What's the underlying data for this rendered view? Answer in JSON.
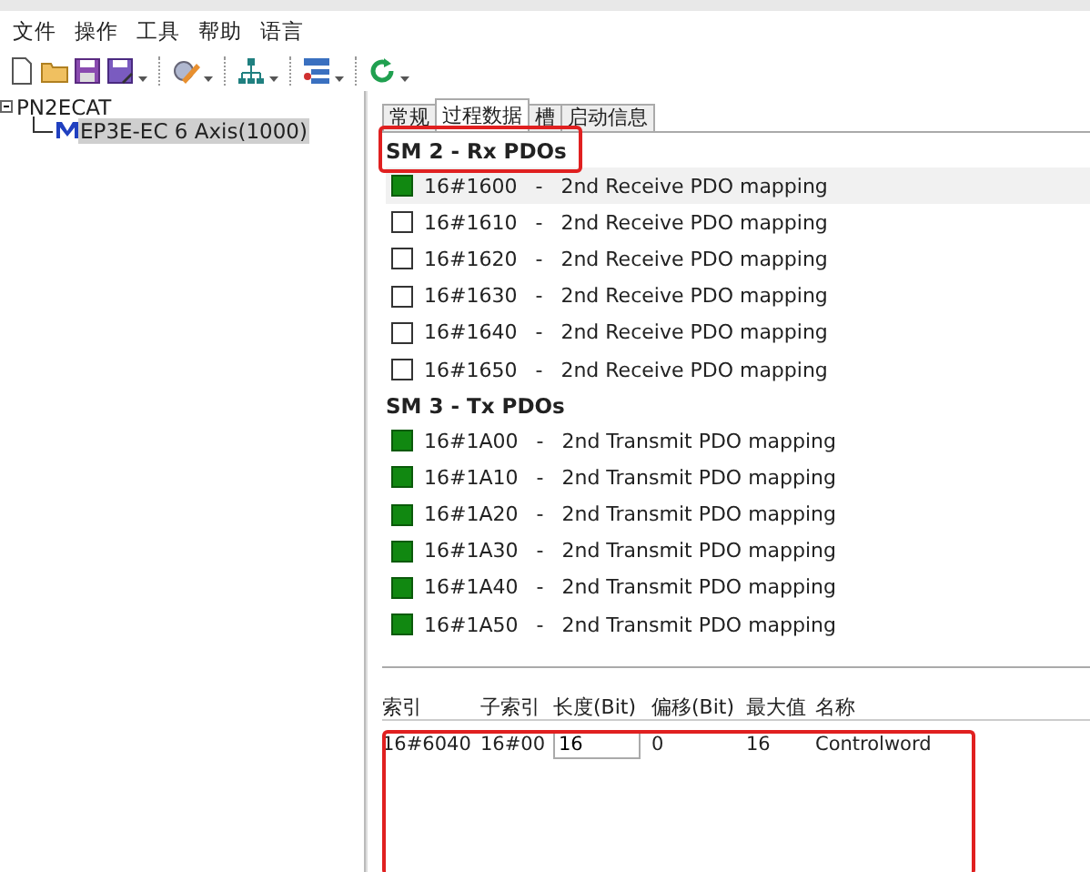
{
  "menu": [
    "文件",
    "操作",
    "工具",
    "帮助",
    "语言"
  ],
  "toolbar": [
    {
      "kind": "new"
    },
    {
      "kind": "open"
    },
    {
      "kind": "save"
    },
    {
      "kind": "saveas",
      "dropdown": true
    },
    {
      "kind": "edit",
      "dropdown": true
    },
    {
      "kind": "network",
      "dropdown": true
    },
    {
      "kind": "list",
      "dropdown": true
    },
    {
      "kind": "refresh",
      "dropdown": true
    }
  ],
  "tree": [
    {
      "label": "PN2ECAT",
      "expanded": true,
      "selected": false,
      "children": [
        {
          "label": "EP3E-EC 6 Axis(1000)",
          "selected": true
        }
      ]
    }
  ],
  "tabs": [
    {
      "label": "常规",
      "selected": false
    },
    {
      "label": "过程数据",
      "selected": true
    },
    {
      "label": "槽",
      "selected": false
    },
    {
      "label": "启动信息",
      "selected": false
    }
  ],
  "groups": [
    {
      "title": "SM 2 - Rx PDOs",
      "highlighted": true,
      "items": [
        {
          "index": "16#1600",
          "sep": "-",
          "name": "2nd Receive PDO mapping",
          "checked": true,
          "selected": true
        },
        {
          "index": "16#1610",
          "sep": "-",
          "name": "2nd Receive PDO mapping",
          "checked": false,
          "selected": false
        },
        {
          "index": "16#1620",
          "sep": "-",
          "name": "2nd Receive PDO mapping",
          "checked": false,
          "selected": false
        },
        {
          "index": "16#1630",
          "sep": "-",
          "name": "2nd Receive PDO mapping",
          "checked": false,
          "selected": false
        },
        {
          "index": "16#1640",
          "sep": "-",
          "name": "2nd Receive PDO mapping",
          "checked": false,
          "selected": false
        },
        {
          "index": "16#1650",
          "sep": "-",
          "name": "2nd Receive PDO mapping",
          "checked": false,
          "selected": false
        }
      ]
    },
    {
      "title": "SM 3 - Tx PDOs",
      "highlighted": false,
      "items": [
        {
          "index": "16#1A00",
          "sep": "-",
          "name": "2nd Transmit PDO mapping",
          "checked": true,
          "selected": false
        },
        {
          "index": "16#1A10",
          "sep": "-",
          "name": "2nd Transmit PDO mapping",
          "checked": true,
          "selected": false
        },
        {
          "index": "16#1A20",
          "sep": "-",
          "name": "2nd Transmit PDO mapping",
          "checked": true,
          "selected": false
        },
        {
          "index": "16#1A30",
          "sep": "-",
          "name": "2nd Transmit PDO mapping",
          "checked": true,
          "selected": false
        },
        {
          "index": "16#1A40",
          "sep": "-",
          "name": "2nd Transmit PDO mapping",
          "checked": true,
          "selected": false
        },
        {
          "index": "16#1A50",
          "sep": "-",
          "name": "2nd Transmit PDO mapping",
          "checked": true,
          "selected": false
        }
      ]
    }
  ],
  "table": {
    "highlighted": true,
    "columns": [
      {
        "label": "索引",
        "kind": "text"
      },
      {
        "label": "子索引",
        "kind": "text"
      },
      {
        "label": "长度(Bit)",
        "kind": "input"
      },
      {
        "label": "偏移(Bit)",
        "kind": "text"
      },
      {
        "label": "最大值",
        "kind": "text"
      },
      {
        "label": "名称",
        "kind": "text"
      }
    ],
    "rows": [
      {
        "cells": [
          "16#6040",
          "16#00",
          "16",
          "0",
          "16",
          "Controlword"
        ]
      }
    ]
  }
}
